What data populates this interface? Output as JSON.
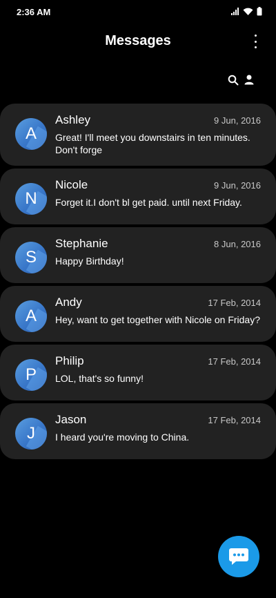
{
  "status": {
    "time": "2:36 AM"
  },
  "header": {
    "title": "Messages"
  },
  "conversations": [
    {
      "initial": "A",
      "name": "Ashley",
      "date": "9 Jun, 2016",
      "preview": "Great! I'll meet you downstairs in ten minutes. Don't forge"
    },
    {
      "initial": "N",
      "name": "Nicole",
      "date": "9 Jun, 2016",
      "preview": "Forget it.I don't bl get paid. until next Friday."
    },
    {
      "initial": "S",
      "name": "Stephanie",
      "date": "8 Jun, 2016",
      "preview": "Happy Birthday!"
    },
    {
      "initial": "A",
      "name": "Andy",
      "date": "17 Feb, 2014",
      "preview": "Hey, want to get together with Nicole on Friday?"
    },
    {
      "initial": "P",
      "name": "Philip",
      "date": "17 Feb, 2014",
      "preview": "LOL, that's so funny!"
    },
    {
      "initial": "J",
      "name": "Jason",
      "date": "17 Feb, 2014",
      "preview": "I heard you're moving to China."
    }
  ],
  "colors": {
    "background": "#000000",
    "card": "#222222",
    "accent": "#1b9ae8",
    "avatar": "#3977c9"
  },
  "icons": {
    "more": "more-vertical-icon",
    "search": "search-icon",
    "contacts": "person-icon",
    "compose": "chat-bubble-icon",
    "signal": "signal-icon",
    "wifi": "wifi-icon",
    "battery": "battery-icon"
  }
}
